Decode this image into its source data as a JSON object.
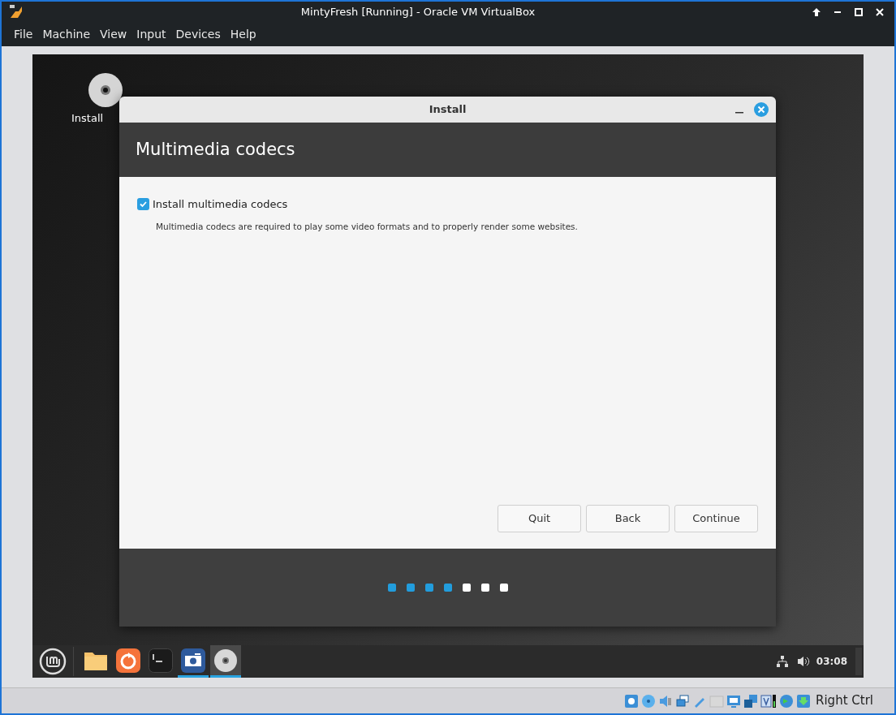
{
  "window": {
    "title": "MintyFresh [Running] - Oracle VM VirtualBox"
  },
  "menu": [
    "File",
    "Machine",
    "View",
    "Input",
    "Devices",
    "Help"
  ],
  "desktop_icon": {
    "label": "Install"
  },
  "dialog": {
    "title": "Install",
    "heading": "Multimedia codecs",
    "option": {
      "label": "Install multimedia codecs",
      "checked": true
    },
    "description": "Multimedia codecs are required to play some video formats and to properly render some websites.",
    "buttons": [
      "Quit",
      "Back",
      "Continue"
    ],
    "steps": [
      {
        "done": true
      },
      {
        "done": true
      },
      {
        "done": true
      },
      {
        "done": true
      },
      {
        "done": false
      },
      {
        "done": false
      },
      {
        "done": false
      }
    ]
  },
  "taskbar": {
    "apps": [
      {
        "kind": "folder",
        "running": false,
        "selected": false
      },
      {
        "kind": "browser",
        "running": false,
        "selected": false
      },
      {
        "kind": "terminal",
        "running": false,
        "selected": false
      },
      {
        "kind": "camera",
        "running": true,
        "selected": false
      },
      {
        "kind": "disc",
        "running": true,
        "selected": true
      }
    ],
    "clock": "03:08"
  },
  "status_bar": {
    "host_key": "Right Ctrl"
  }
}
